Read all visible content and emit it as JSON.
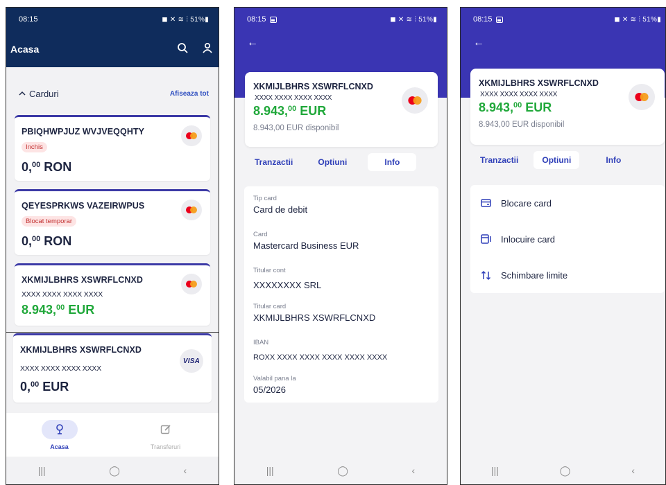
{
  "status": {
    "time": "08:15",
    "system_icons": "◼ ✕ ≋ ⫶ 51%▮"
  },
  "screen1": {
    "title": "Acasa",
    "section_title": "Carduri",
    "section_link": "Afiseaza tot",
    "cards": [
      {
        "name": "PBIQHWPJUZ WVJVEQQHTY",
        "badge": "Inchis",
        "amount_int": "0,",
        "amount_dec": "00",
        "currency": " RON",
        "logo": "mastercard"
      },
      {
        "name": "QEYESPRKWS VAZEIRWPUS",
        "badge": "Blocat temporar",
        "amount_int": "0,",
        "amount_dec": "00",
        "currency": " RON",
        "logo": "mastercard"
      },
      {
        "name": "XKMIJLBHRS XSWRFLCNXD",
        "masked": "XXXX XXXX XXXX XXXX",
        "amount_int": "8.943,",
        "amount_dec": "00",
        "currency": " EUR",
        "logo": "mastercard"
      },
      {
        "name": "XKMIJLBHRS XSWRFLCNXD",
        "masked": "XXXX XXXX XXXX XXXX",
        "amount_int": "0,",
        "amount_dec": "00",
        "currency": " EUR",
        "logo": "VISA"
      }
    ],
    "nav": [
      {
        "label": "Acasa",
        "icon": "home-pin-icon"
      },
      {
        "label": "Transferuri",
        "icon": "edit-icon"
      }
    ]
  },
  "account": {
    "name": "XKMIJLBHRS XSWRFLCNXD",
    "masked": "XXXX XXXX XXXX XXXX",
    "amount_int": "8.943,",
    "amount_dec": "00",
    "currency": " EUR",
    "available": "8.943,00 EUR disponibil"
  },
  "tabs": [
    "Tranzactii",
    "Optiuni",
    "Info"
  ],
  "info": [
    {
      "label": "Tip card",
      "value": "Card de debit"
    },
    {
      "label": "Card",
      "value": "Mastercard Business EUR"
    },
    {
      "label": "Titular cont",
      "value": "XXXXXXXX SRL"
    },
    {
      "label": "Titular card",
      "value": "XKMIJLBHRS XSWRFLCNXD"
    },
    {
      "label": "IBAN",
      "value": "ROXX XXXX XXXX XXXX XXXX XXXX"
    },
    {
      "label": "Valabil pana la",
      "value": "05/2026"
    }
  ],
  "options": [
    {
      "label": "Blocare card",
      "icon": "card-lock-icon"
    },
    {
      "label": "Inlocuire card",
      "icon": "card-replace-icon"
    },
    {
      "label": "Schimbare limite",
      "icon": "swap-arrows-icon"
    }
  ],
  "colors": {
    "header_navy": "#0f2c5c",
    "header_purple": "#3a35b3",
    "accent_blue": "#2f3fb8",
    "amount_green": "#20a83a",
    "badge_red": "#c23030"
  }
}
